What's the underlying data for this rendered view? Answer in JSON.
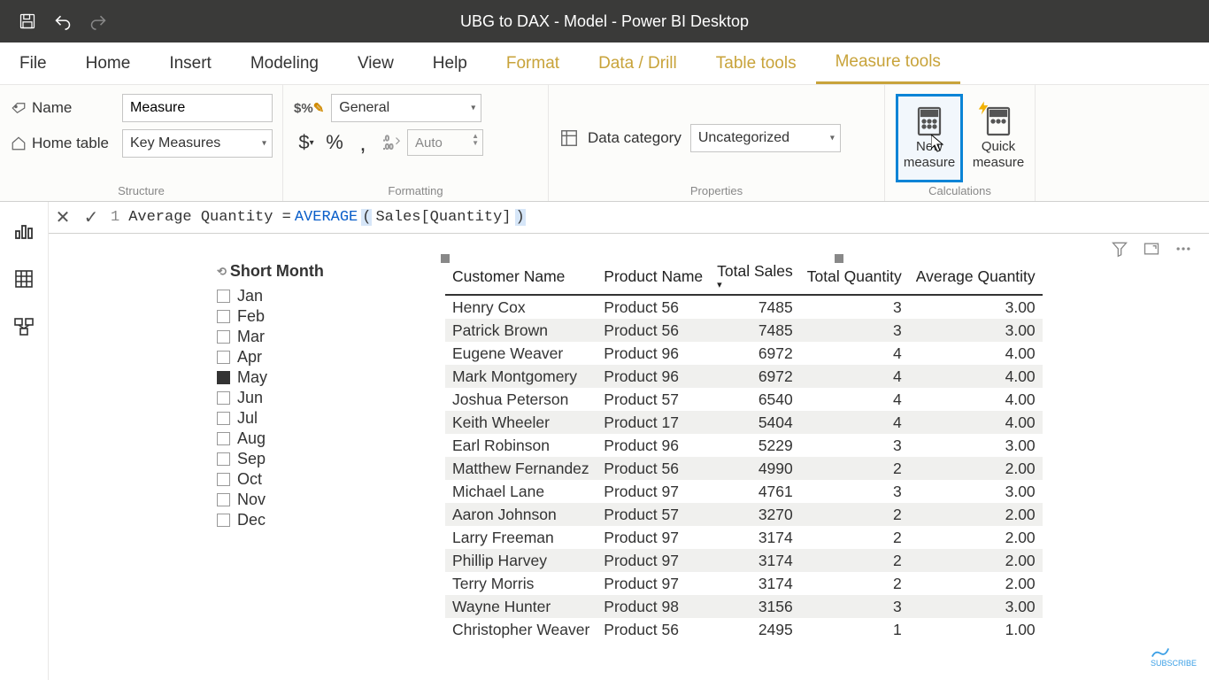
{
  "titlebar": {
    "title": "UBG to DAX - Model - Power BI Desktop"
  },
  "tabs": {
    "file": "File",
    "items": [
      "Home",
      "Insert",
      "Modeling",
      "View",
      "Help",
      "Format",
      "Data / Drill",
      "Table tools",
      "Measure tools"
    ],
    "context_from_index": 5,
    "active_index": 8
  },
  "ribbon": {
    "structure": {
      "name_label": "Name",
      "name_value": "Measure",
      "home_table_label": "Home table",
      "home_table_value": "Key Measures",
      "group_label": "Structure"
    },
    "formatting": {
      "format_value": "General",
      "decimal_placeholder": "Auto",
      "group_label": "Formatting"
    },
    "properties": {
      "category_label": "Data category",
      "category_value": "Uncategorized",
      "group_label": "Properties"
    },
    "calculations": {
      "new_measure": "New measure",
      "quick_measure": "Quick measure",
      "group_label": "Calculations"
    }
  },
  "formula": {
    "line_no": "1",
    "text_prefix": "Average Quantity = ",
    "func": "AVERAGE",
    "open": "(",
    "arg": " Sales[Quantity] ",
    "close": ")"
  },
  "slicer": {
    "title": "Short Month",
    "items": [
      {
        "label": "Jan",
        "checked": false
      },
      {
        "label": "Feb",
        "checked": false
      },
      {
        "label": "Mar",
        "checked": false
      },
      {
        "label": "Apr",
        "checked": false
      },
      {
        "label": "May",
        "checked": true
      },
      {
        "label": "Jun",
        "checked": false
      },
      {
        "label": "Jul",
        "checked": false
      },
      {
        "label": "Aug",
        "checked": false
      },
      {
        "label": "Sep",
        "checked": false
      },
      {
        "label": "Oct",
        "checked": false
      },
      {
        "label": "Nov",
        "checked": false
      },
      {
        "label": "Dec",
        "checked": false
      }
    ]
  },
  "table": {
    "headers": [
      "Customer Name",
      "Product Name",
      "Total Sales",
      "Total Quantity",
      "Average Quantity"
    ],
    "sort_col": 2,
    "rows": [
      [
        "Henry Cox",
        "Product 56",
        "7485",
        "3",
        "3.00"
      ],
      [
        "Patrick Brown",
        "Product 56",
        "7485",
        "3",
        "3.00"
      ],
      [
        "Eugene Weaver",
        "Product 96",
        "6972",
        "4",
        "4.00"
      ],
      [
        "Mark Montgomery",
        "Product 96",
        "6972",
        "4",
        "4.00"
      ],
      [
        "Joshua Peterson",
        "Product 57",
        "6540",
        "4",
        "4.00"
      ],
      [
        "Keith Wheeler",
        "Product 17",
        "5404",
        "4",
        "4.00"
      ],
      [
        "Earl Robinson",
        "Product 96",
        "5229",
        "3",
        "3.00"
      ],
      [
        "Matthew Fernandez",
        "Product 56",
        "4990",
        "2",
        "2.00"
      ],
      [
        "Michael Lane",
        "Product 97",
        "4761",
        "3",
        "3.00"
      ],
      [
        "Aaron Johnson",
        "Product 57",
        "3270",
        "2",
        "2.00"
      ],
      [
        "Larry Freeman",
        "Product 97",
        "3174",
        "2",
        "2.00"
      ],
      [
        "Phillip Harvey",
        "Product 97",
        "3174",
        "2",
        "2.00"
      ],
      [
        "Terry Morris",
        "Product 97",
        "3174",
        "2",
        "2.00"
      ],
      [
        "Wayne Hunter",
        "Product 98",
        "3156",
        "3",
        "3.00"
      ],
      [
        "Christopher Weaver",
        "Product 56",
        "2495",
        "1",
        "1.00"
      ]
    ]
  },
  "subscribe": "SUBSCRIBE"
}
